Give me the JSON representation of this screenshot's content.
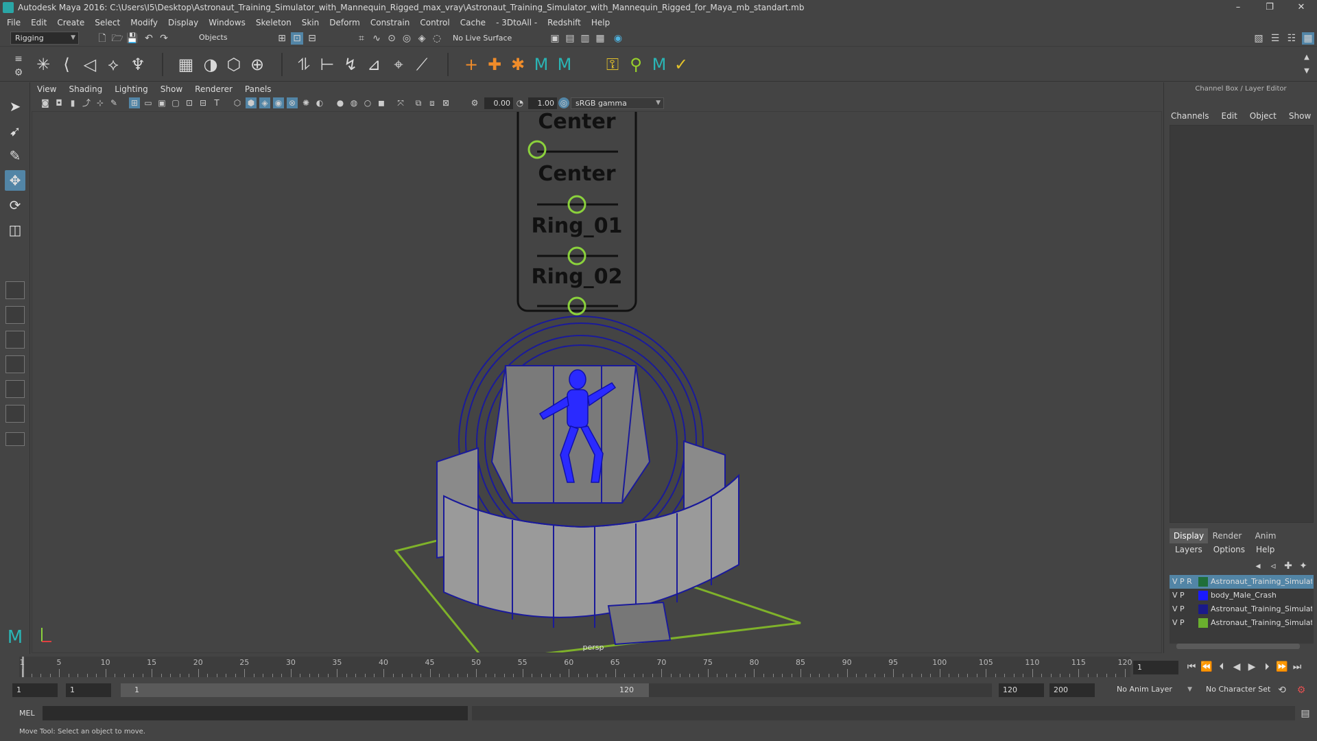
{
  "window": {
    "title": "Autodesk Maya 2016: C:\\Users\\I5\\Desktop\\Astronaut_Training_Simulator_with_Mannequin_Rigged_max_vray\\Astronaut_Training_Simulator_with_Mannequin_Rigged_for_Maya_mb_standart.mb",
    "minimize": "–",
    "maximize": "❐",
    "close": "✕"
  },
  "menubar": [
    "File",
    "Edit",
    "Create",
    "Select",
    "Modify",
    "Display",
    "Windows",
    "Skeleton",
    "Skin",
    "Deform",
    "Constrain",
    "Control",
    "Cache",
    "- 3DtoAll -",
    "Redshift",
    "Help"
  ],
  "statusline": {
    "menuset": "Rigging",
    "selection_mode": "Objects",
    "live_surface": "No Live Surface"
  },
  "panel": {
    "menu": [
      "View",
      "Shading",
      "Lighting",
      "Show",
      "Renderer",
      "Panels"
    ],
    "exposure": "0.00",
    "gamma": "1.00",
    "color_space": "sRGB gamma",
    "camera_label": "persp"
  },
  "scene": {
    "control_labels": [
      "Center",
      "Center",
      "Ring_01",
      "Ring_02"
    ],
    "colors": {
      "wire": "#1a1a9a",
      "mannequin": "#2a2aff",
      "ground": "#7fb22a",
      "controls": "#8bd23c"
    }
  },
  "channelbox": {
    "title": "Channel Box / Layer Editor",
    "menu": [
      "Channels",
      "Edit",
      "Object",
      "Show"
    ],
    "layer_tabs": [
      "Display",
      "Render",
      "Anim"
    ],
    "active_tab": "Display",
    "layer_menu": [
      "Layers",
      "Options",
      "Help"
    ],
    "layers": [
      {
        "flags": "V P R",
        "color": "#1f6e3a",
        "name": "Astronaut_Training_Simulato",
        "selected": true
      },
      {
        "flags": "V    P",
        "color": "#1a1aff",
        "name": "body_Male_Crash",
        "selected": false
      },
      {
        "flags": "V  P",
        "color": "#1a1a8a",
        "name": "Astronaut_Training_Simulato",
        "selected": false
      },
      {
        "flags": "V  P",
        "color": "#6ab02e",
        "name": "Astronaut_Training_Simulato",
        "selected": false
      }
    ]
  },
  "timeslider": {
    "ticks": [
      "1",
      "5",
      "10",
      "15",
      "20",
      "25",
      "30",
      "35",
      "40",
      "45",
      "50",
      "55",
      "60",
      "65",
      "70",
      "75",
      "80",
      "85",
      "90",
      "95",
      "100",
      "105",
      "110",
      "115",
      "120"
    ],
    "current_frame": "1"
  },
  "rangeslider": {
    "start": "1",
    "playback_start": "1",
    "range_left": "1",
    "range_right": "120",
    "playback_end": "120",
    "end": "200",
    "anim_layer": "No Anim Layer",
    "character_set": "No Character Set"
  },
  "cmdline": {
    "label": "MEL"
  },
  "helpline": "Move Tool: Select an object to move."
}
